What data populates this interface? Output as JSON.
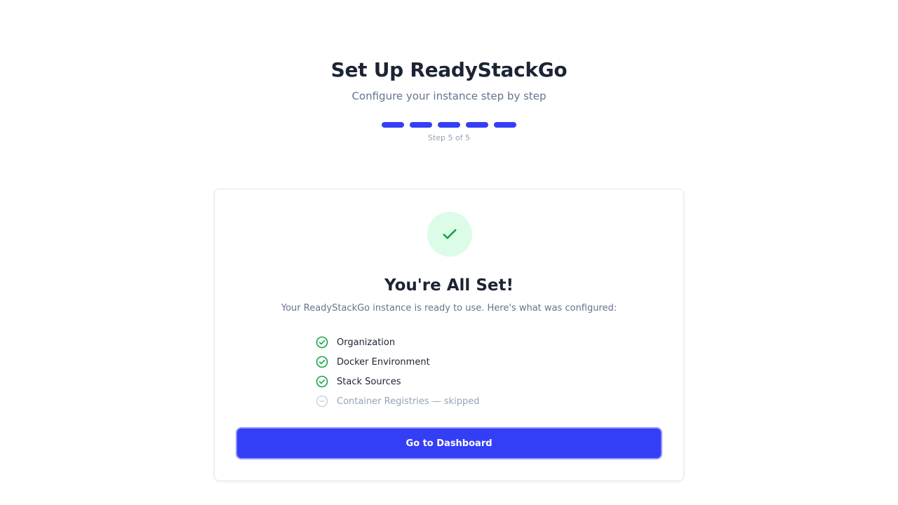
{
  "header": {
    "title": "Set Up ReadyStackGo",
    "subtitle": "Configure your instance step by step",
    "progress": {
      "total_steps": 5,
      "completed_steps": 5,
      "label": "Step 5 of 5"
    }
  },
  "completion_card": {
    "icon": "check-icon",
    "title": "You're All Set!",
    "description": "Your ReadyStackGo instance is ready to use. Here's what was configured:",
    "items": [
      {
        "label": "Organization",
        "status": "done",
        "icon": "check-circle-icon"
      },
      {
        "label": "Docker Environment",
        "status": "done",
        "icon": "check-circle-icon"
      },
      {
        "label": "Stack Sources",
        "status": "done",
        "icon": "check-circle-icon"
      },
      {
        "label": "Container Registries — skipped",
        "status": "skipped",
        "icon": "minus-circle-icon"
      }
    ],
    "primary_button_label": "Go to Dashboard"
  },
  "colors": {
    "accent": "#343ff5",
    "success": "#16a34a",
    "success_bg": "#dcfce7",
    "muted": "#94a3b8"
  }
}
